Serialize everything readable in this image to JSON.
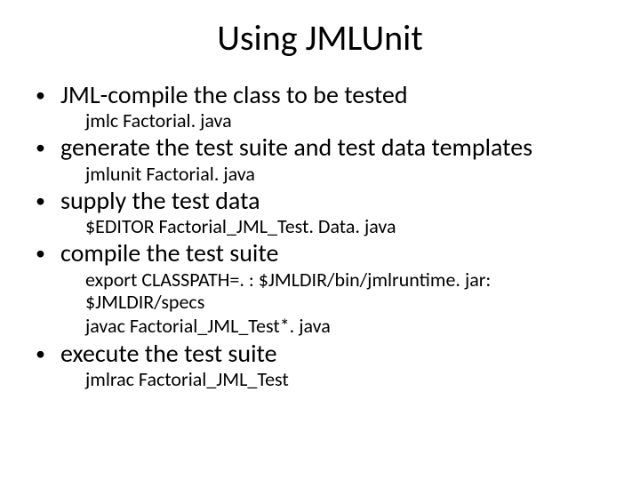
{
  "title": "Using JMLUnit",
  "items": [
    {
      "bullet": "JML-compile the class to be tested",
      "subs": [
        "jmlc Factorial. java"
      ]
    },
    {
      "bullet": "generate the test suite and test data templates",
      "subs": [
        "jmlunit Factorial. java"
      ]
    },
    {
      "bullet": "supply the test data",
      "subs": [
        "$EDITOR  Factorial_JML_Test. Data. java"
      ]
    },
    {
      "bullet": "compile the test suite",
      "subs": [
        "export CLASSPATH=. : $JMLDIR/bin/jmlruntime. jar: $JMLDIR/specs",
        "javac Factorial_JML_Test*. java"
      ]
    },
    {
      "bullet": "execute the test suite",
      "subs": [
        "jmlrac Factorial_JML_Test"
      ]
    }
  ]
}
